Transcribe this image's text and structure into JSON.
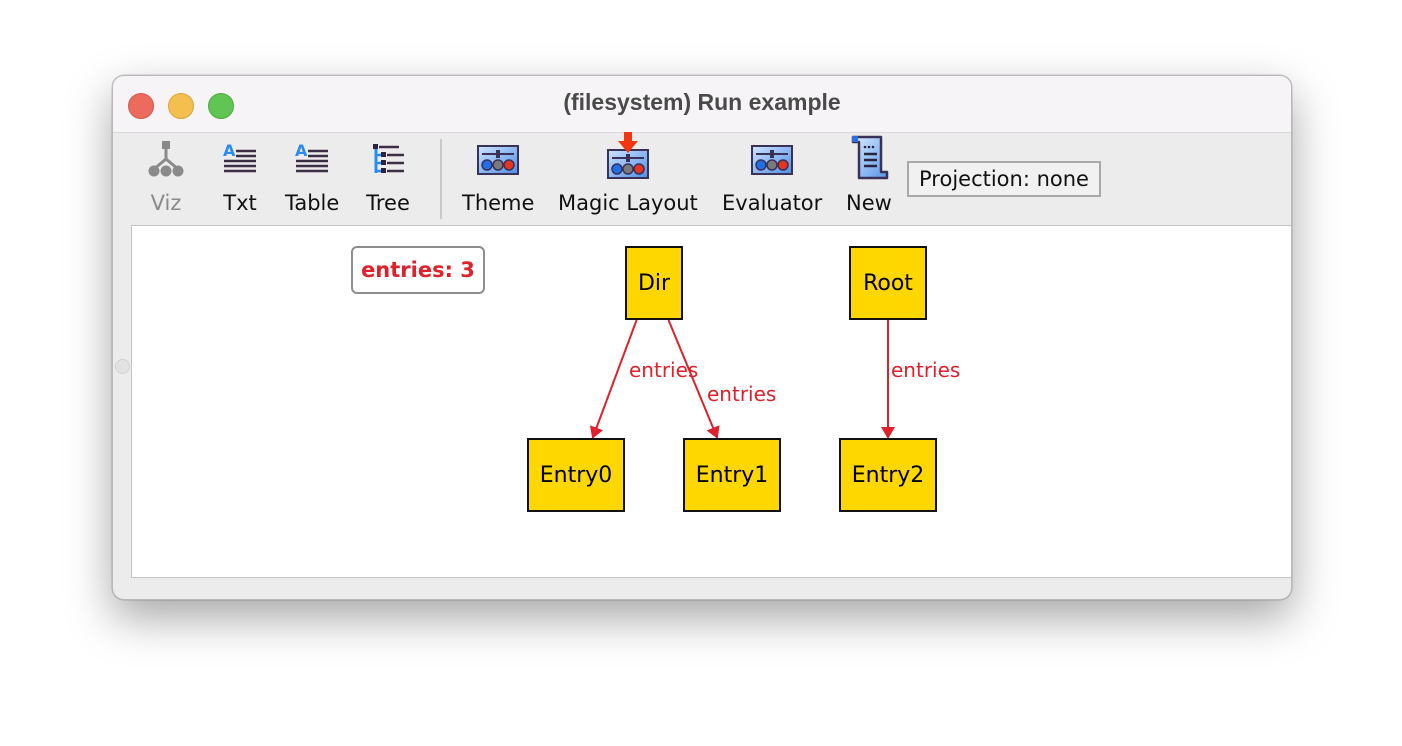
{
  "window": {
    "title": "(filesystem) Run example"
  },
  "toolbar": {
    "items": [
      {
        "label": "Viz",
        "icon": "graph-tree-icon",
        "enabled": false
      },
      {
        "label": "Txt",
        "icon": "text-lines-icon",
        "enabled": true
      },
      {
        "label": "Table",
        "icon": "table-lines-icon",
        "enabled": true
      },
      {
        "label": "Tree",
        "icon": "tree-list-icon",
        "enabled": true
      },
      {
        "label": "Theme",
        "icon": "theme-sliders-icon",
        "enabled": true
      },
      {
        "label": "Magic Layout",
        "icon": "magic-layout-icon",
        "enabled": true
      },
      {
        "label": "Evaluator",
        "icon": "evaluator-sliders-icon",
        "enabled": true
      },
      {
        "label": "New",
        "icon": "new-scroll-icon",
        "enabled": true
      }
    ],
    "projection_label": "Projection: none"
  },
  "graph": {
    "summary_badge": "entries: 3",
    "nodes": [
      {
        "id": "dir",
        "label": "Dir"
      },
      {
        "id": "root",
        "label": "Root"
      },
      {
        "id": "entry0",
        "label": "Entry0"
      },
      {
        "id": "entry1",
        "label": "Entry1"
      },
      {
        "id": "entry2",
        "label": "Entry2"
      }
    ],
    "edges": [
      {
        "from": "dir",
        "to": "entry0",
        "label": "entries"
      },
      {
        "from": "dir",
        "to": "entry1",
        "label": "entries"
      },
      {
        "from": "root",
        "to": "entry2",
        "label": "entries"
      }
    ],
    "colors": {
      "node_fill": "#ffd700",
      "edge": "#e0202a",
      "badge_text": "#e0202a"
    }
  }
}
